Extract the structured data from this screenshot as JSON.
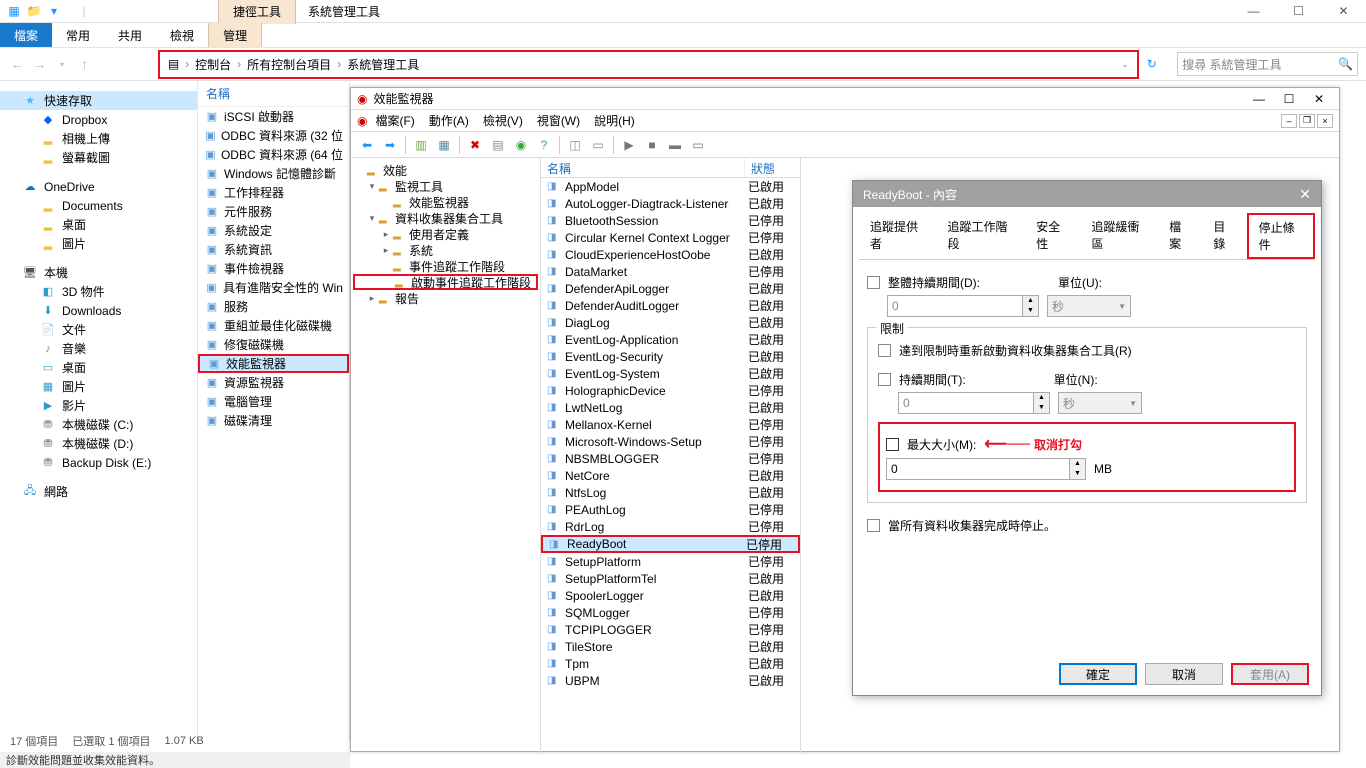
{
  "titlebar": {
    "tool_tab": "捷徑工具",
    "title": "系統管理工具"
  },
  "ribbon": {
    "file": "檔案",
    "home": "常用",
    "share": "共用",
    "view": "檢視",
    "manage": "管理"
  },
  "breadcrumb": {
    "b1": "控制台",
    "b2": "所有控制台項目",
    "b3": "系統管理工具"
  },
  "search": {
    "placeholder": "搜尋 系統管理工具"
  },
  "nav": {
    "quick": "快速存取",
    "dropbox": "Dropbox",
    "camera": "相機上傳",
    "screenshot": "螢幕截圖",
    "onedrive": "OneDrive",
    "documents": "Documents",
    "desktop": "桌面",
    "pictures": "圖片",
    "thispc": "本機",
    "obj3d": "3D 物件",
    "downloads": "Downloads",
    "docs2": "文件",
    "music": "音樂",
    "desktop2": "桌面",
    "pics2": "圖片",
    "videos": "影片",
    "diskc": "本機磁碟 (C:)",
    "diskd": "本機磁碟 (D:)",
    "diske": "Backup Disk (E:)",
    "network": "網路"
  },
  "content": {
    "name_hdr": "名稱",
    "items": [
      "iSCSI 啟動器",
      "ODBC 資料來源 (32 位",
      "ODBC 資料來源 (64 位",
      "Windows 記憶體診斷",
      "工作排程器",
      "元件服務",
      "系統設定",
      "系統資訊",
      "事件檢視器",
      "具有進階安全性的 Win",
      "服務",
      "重組並最佳化磁碟機",
      "修復磁碟機",
      "效能監視器",
      "資源監視器",
      "電腦管理",
      "磁碟清理"
    ],
    "hl_index": 13
  },
  "perf": {
    "title": "效能監視器",
    "menu": {
      "file": "檔案(F)",
      "action": "動作(A)",
      "view": "檢視(V)",
      "window": "視窗(W)",
      "help": "說明(H)"
    },
    "tree": [
      {
        "d": 0,
        "t": "效能",
        "exp": ""
      },
      {
        "d": 1,
        "t": "監視工具",
        "exp": "▾"
      },
      {
        "d": 2,
        "t": "效能監視器",
        "exp": ""
      },
      {
        "d": 1,
        "t": "資料收集器集合工具",
        "exp": "▾"
      },
      {
        "d": 2,
        "t": "使用者定義",
        "exp": "▸"
      },
      {
        "d": 2,
        "t": "系統",
        "exp": "▸"
      },
      {
        "d": 2,
        "t": "事件追蹤工作階段",
        "exp": ""
      },
      {
        "d": 2,
        "t": "啟動事件追蹤工作階段",
        "exp": "",
        "hl": true
      },
      {
        "d": 1,
        "t": "報告",
        "exp": "▸"
      }
    ],
    "list": {
      "h1": "名稱",
      "h2": "狀態",
      "rows": [
        [
          "AppModel",
          "已啟用"
        ],
        [
          "AutoLogger-Diagtrack-Listener",
          "已啟用"
        ],
        [
          "BluetoothSession",
          "已停用"
        ],
        [
          "Circular Kernel Context Logger",
          "已停用"
        ],
        [
          "CloudExperienceHostOobe",
          "已啟用"
        ],
        [
          "DataMarket",
          "已停用"
        ],
        [
          "DefenderApiLogger",
          "已啟用"
        ],
        [
          "DefenderAuditLogger",
          "已啟用"
        ],
        [
          "DiagLog",
          "已啟用"
        ],
        [
          "EventLog-Application",
          "已啟用"
        ],
        [
          "EventLog-Security",
          "已啟用"
        ],
        [
          "EventLog-System",
          "已啟用"
        ],
        [
          "HolographicDevice",
          "已停用"
        ],
        [
          "LwtNetLog",
          "已啟用"
        ],
        [
          "Mellanox-Kernel",
          "已停用"
        ],
        [
          "Microsoft-Windows-Setup",
          "已停用"
        ],
        [
          "NBSMBLOGGER",
          "已停用"
        ],
        [
          "NetCore",
          "已啟用"
        ],
        [
          "NtfsLog",
          "已啟用"
        ],
        [
          "PEAuthLog",
          "已停用"
        ],
        [
          "RdrLog",
          "已停用"
        ],
        [
          "ReadyBoot",
          "已停用"
        ],
        [
          "SetupPlatform",
          "已停用"
        ],
        [
          "SetupPlatformTel",
          "已啟用"
        ],
        [
          "SpoolerLogger",
          "已啟用"
        ],
        [
          "SQMLogger",
          "已停用"
        ],
        [
          "TCPIPLOGGER",
          "已停用"
        ],
        [
          "TileStore",
          "已啟用"
        ],
        [
          "Tpm",
          "已啟用"
        ],
        [
          "UBPM",
          "已啟用"
        ]
      ],
      "sel_index": 21
    }
  },
  "dlg": {
    "title": "ReadyBoot - 內容",
    "tabs": [
      "追蹤提供者",
      "追蹤工作階段",
      "安全性",
      "追蹤緩衝區",
      "檔案",
      "目錄",
      "停止條件"
    ],
    "active_tab": 6,
    "overall_label": "整體持續期間(D):",
    "unit_label_u": "單位(U):",
    "overall_val": "0",
    "unit_sec": "秒",
    "limit_label": "限制",
    "restart_label": "達到限制時重新啟動資料收集器集合工具(R)",
    "duration_label": "持續期間(T):",
    "unit_label_n": "單位(N):",
    "duration_val": "0",
    "maxsize_label": "最大大小(M):",
    "maxsize_val": "0",
    "mb": "MB",
    "annot": "取消打勾",
    "stopall_label": "當所有資料收集器完成時停止。",
    "ok": "確定",
    "cancel": "取消",
    "apply": "套用(A)"
  },
  "status": {
    "count": "17 個項目",
    "sel": "已選取 1 個項目",
    "size": "1.07 KB",
    "bottom": "診斷效能問題並收集效能資料。"
  }
}
